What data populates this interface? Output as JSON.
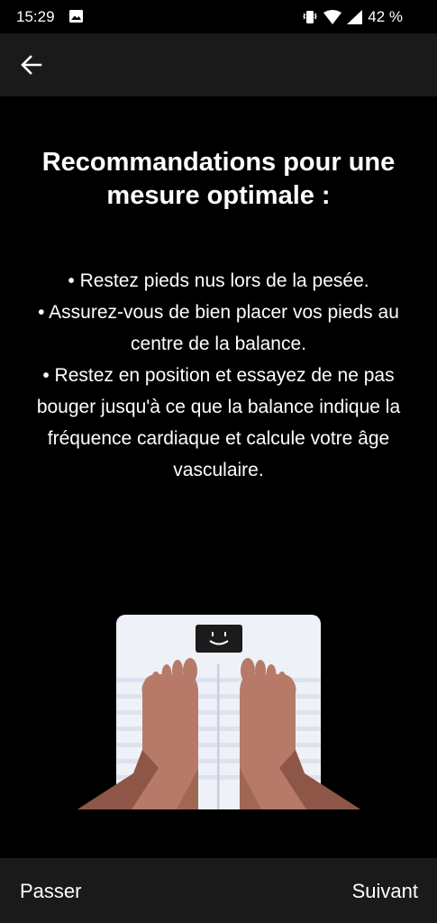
{
  "status_bar": {
    "time": "15:29",
    "battery": "42 %",
    "icons": [
      "image-icon",
      "vibrate-icon",
      "wifi-icon",
      "signal-icon",
      "battery-icon"
    ]
  },
  "app_bar": {
    "back_icon": "arrow-left-icon"
  },
  "content": {
    "title": "Recommandations pour une mesure optimale :",
    "tips": [
      "• Restez pieds nus lors de la pesée.",
      "• Assurez-vous de bien placer vos pieds au centre de la balance.",
      "• Restez en position et essayez de ne pas bouger jusqu'à ce que la balance indique la fréquence cardiaque et calcule votre âge vasculaire."
    ]
  },
  "footer": {
    "skip_label": "Passer",
    "next_label": "Suivant"
  },
  "colors": {
    "background": "#000000",
    "bar": "#1a1a1a",
    "scale": "#eef1f8",
    "skin": "#b77a68",
    "skin_shadow": "#8e5646"
  }
}
